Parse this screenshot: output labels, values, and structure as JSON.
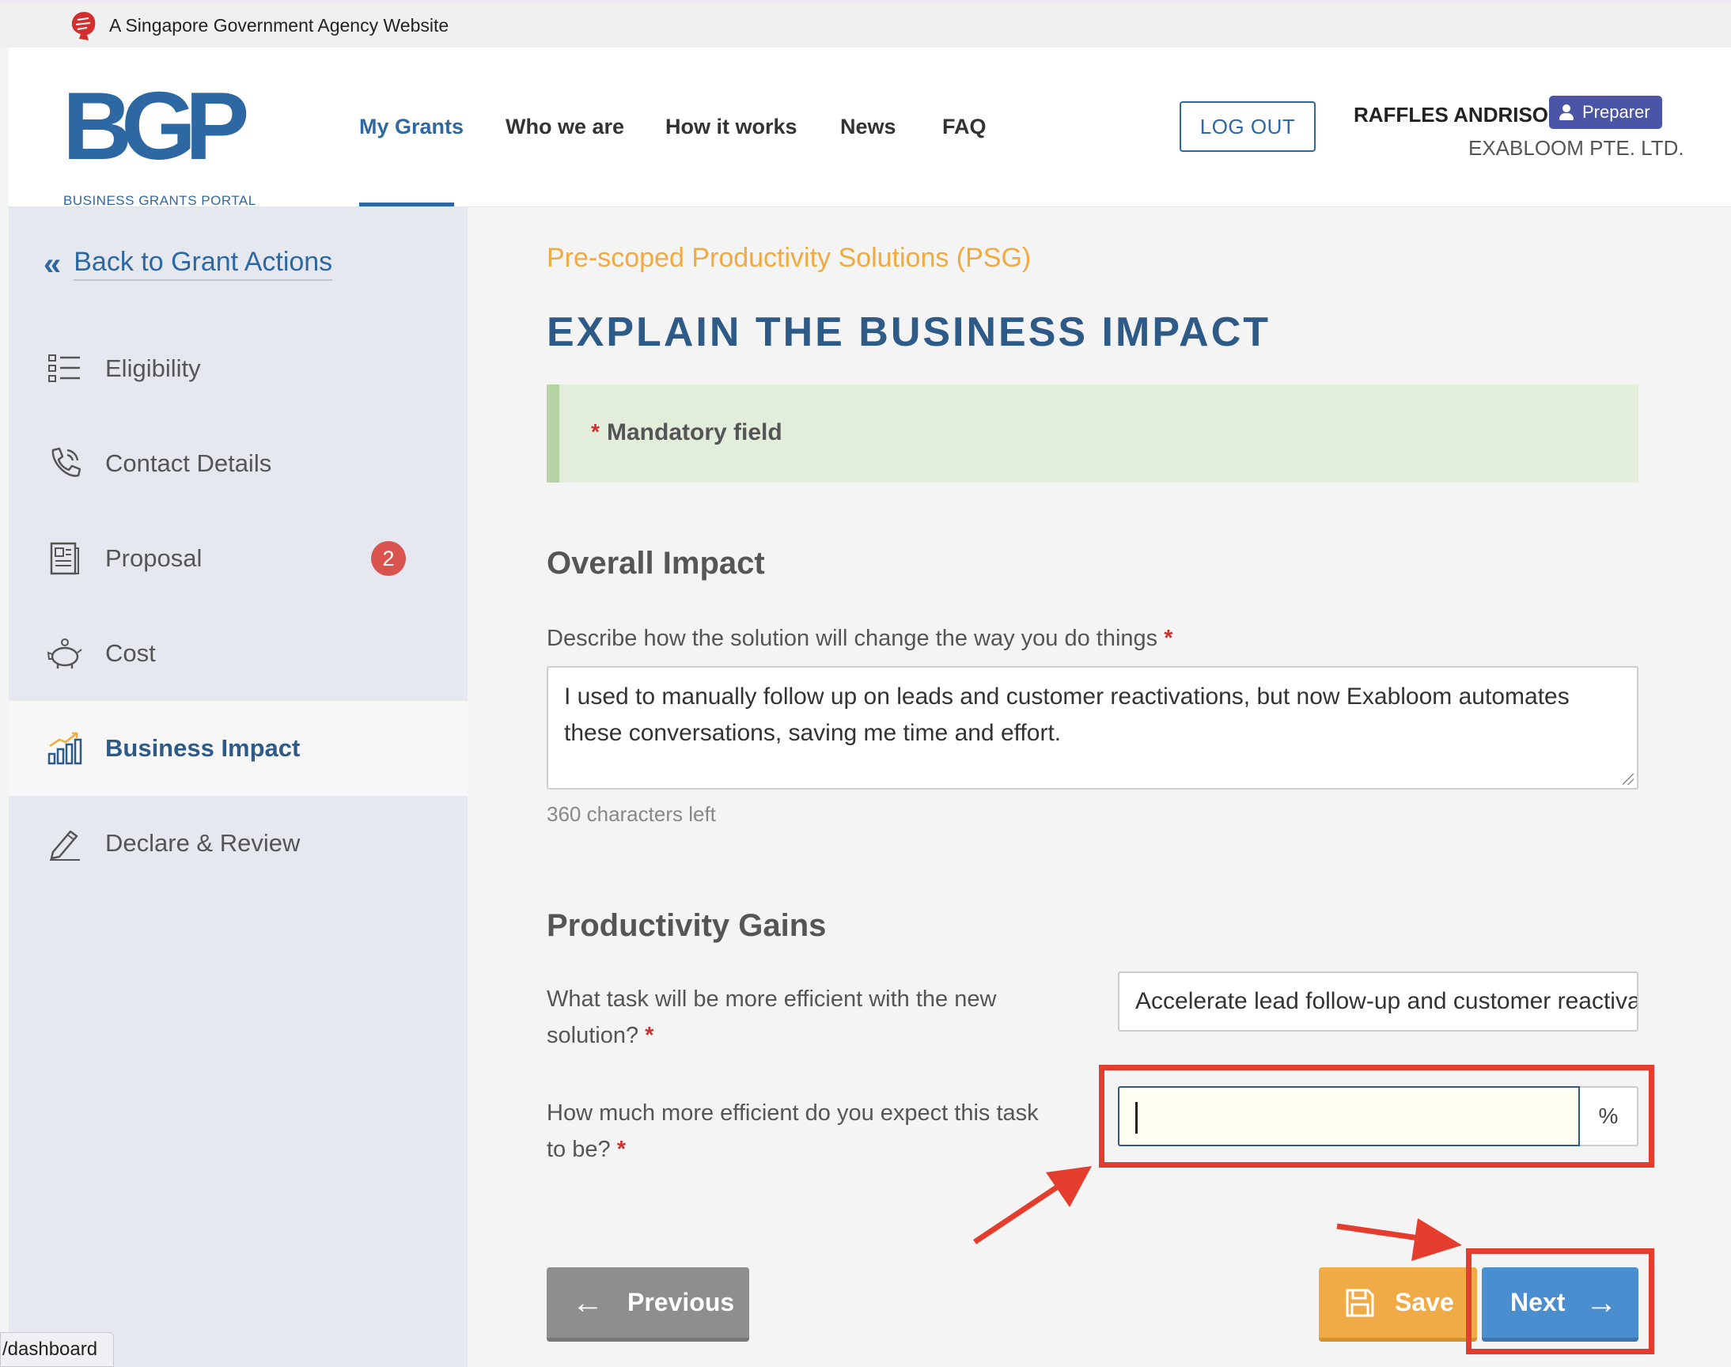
{
  "masthead": {
    "text": "A Singapore Government Agency Website"
  },
  "logo": {
    "mark": "BGP",
    "subtitle": "BUSINESS GRANTS PORTAL"
  },
  "nav": {
    "items": [
      "My Grants",
      "Who we are",
      "How it works",
      "News",
      "FAQ"
    ],
    "active": "My Grants"
  },
  "user": {
    "logout_label": "LOG OUT",
    "name": "RAFFLES ANDRISON",
    "role": "Preparer",
    "company": "EXABLOOM PTE. LTD."
  },
  "sidebar": {
    "back_label": "Back to Grant Actions",
    "items": [
      {
        "label": "Eligibility",
        "icon": "checklist-icon"
      },
      {
        "label": "Contact Details",
        "icon": "phone-icon"
      },
      {
        "label": "Proposal",
        "icon": "document-icon",
        "badge": "2"
      },
      {
        "label": "Cost",
        "icon": "piggy-bank-icon"
      },
      {
        "label": "Business Impact",
        "icon": "bar-chart-icon",
        "active": true
      },
      {
        "label": "Declare & Review",
        "icon": "pen-icon"
      }
    ]
  },
  "main": {
    "eyebrow": "Pre-scoped Productivity Solutions (PSG)",
    "title": "EXPLAIN THE BUSINESS IMPACT",
    "notice": {
      "star": "*",
      "text": "Mandatory field"
    },
    "overall": {
      "title": "Overall Impact",
      "label": "Describe how the solution will change the way you do things",
      "value": "I used to manually follow up on leads and customer reactivations, but now Exabloom automates these conversations, saving me time and effort.",
      "chars_left": "360 characters left"
    },
    "productivity": {
      "title": "Productivity Gains",
      "task_label_1": "What task will be more efficient with the new",
      "task_label_2": "solution?",
      "task_value": "Accelerate lead follow-up and customer reactivation",
      "eff_label_1": "How much more efficient do you expect this task",
      "eff_label_2": "to be?",
      "eff_value": "",
      "eff_suffix": "%"
    },
    "buttons": {
      "previous": "Previous",
      "save": "Save",
      "next": "Next"
    }
  },
  "required_marker": "*",
  "statusbar": {
    "text": "/dashboard"
  },
  "colors": {
    "brand_blue": "#2e68a3",
    "accent_orange": "#f0aa40",
    "annotation_red": "#e43d2e",
    "next_blue": "#4b8ecf",
    "save_orange": "#f0ab47"
  }
}
